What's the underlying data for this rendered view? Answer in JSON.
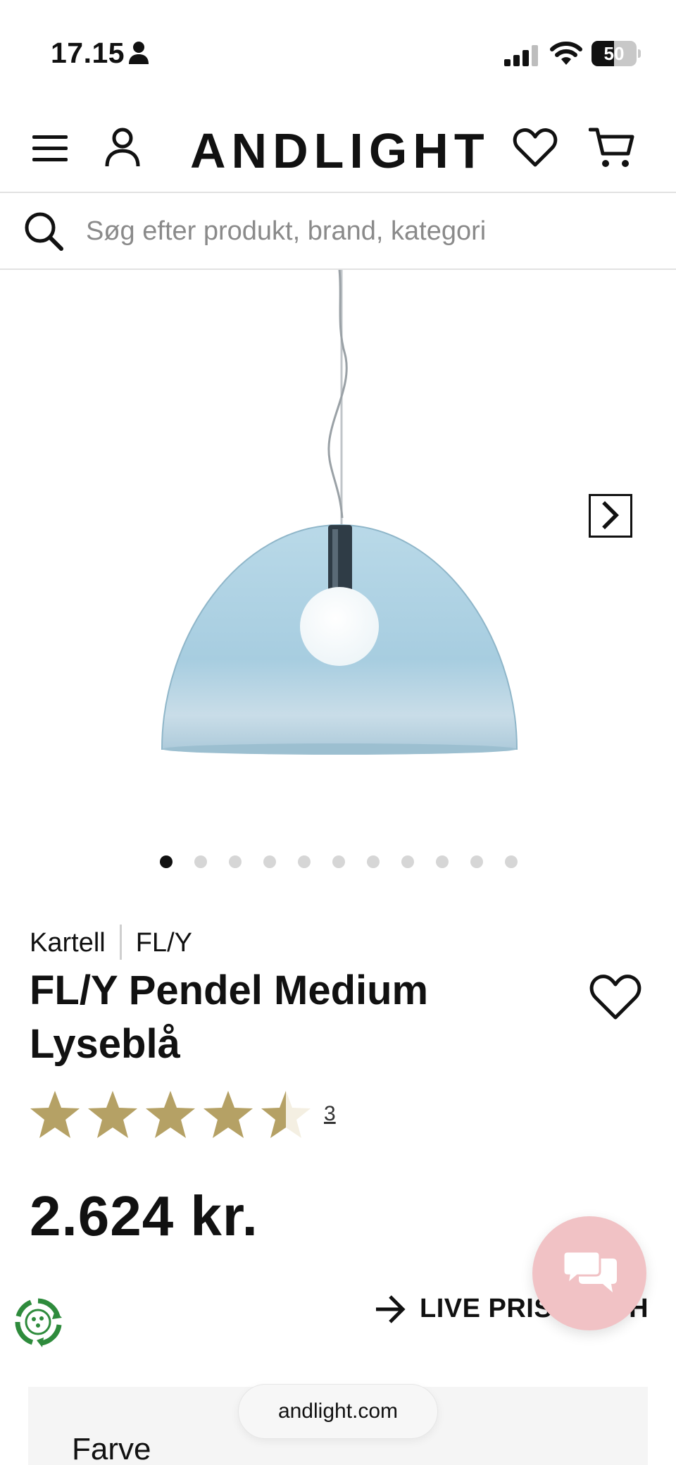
{
  "status_bar": {
    "time": "17.15",
    "battery": "50",
    "battery_level": 0.5
  },
  "header": {
    "logo": "ANDLIGHT",
    "icons": [
      "menu-icon",
      "account-icon",
      "heart-icon",
      "cart-icon"
    ]
  },
  "search": {
    "placeholder": "Søg efter produkt, brand, kategori",
    "value": ""
  },
  "gallery": {
    "image_count": 11,
    "active_index": 0,
    "next_icon": "chevron-right-icon"
  },
  "product": {
    "brand": "Kartell",
    "series": "FL/Y",
    "title": "FL/Y Pendel Medium Lyseblå",
    "rating_value": 4.5,
    "rating_max": 5,
    "review_count": "3",
    "price": "2.624 kr."
  },
  "live_match": {
    "label": "LIVE PRISMATCH"
  },
  "options": {
    "color_label": "Farve"
  },
  "browser": {
    "url": "andlight.com"
  },
  "colors": {
    "star": "#b5a165",
    "chat_bubble": "#f1c2c5",
    "eco_green": "#2e8b3c",
    "lamp_blue": "#a9cfe0"
  }
}
